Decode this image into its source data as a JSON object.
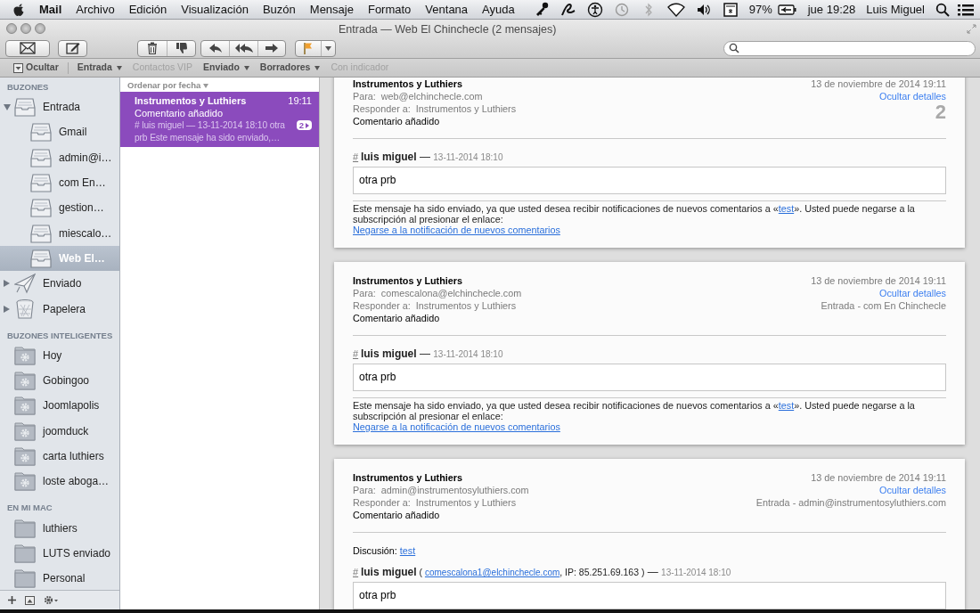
{
  "menubar": {
    "app": "Mail",
    "menus": [
      "Archivo",
      "Edición",
      "Visualización",
      "Buzón",
      "Mensaje",
      "Formato",
      "Ventana",
      "Ayuda"
    ],
    "battery": "97%",
    "clock": "jue 19:28",
    "user": "Luis Miguel"
  },
  "window": {
    "title": "Entrada — Web El Chinchecle (2 mensajes)"
  },
  "favorites": [
    {
      "label": "Ocultar",
      "kind": "hide",
      "disabled": false
    },
    {
      "label": "Entrada",
      "kind": "menu",
      "disabled": false
    },
    {
      "label": "Contactos VIP",
      "kind": "plain",
      "disabled": true
    },
    {
      "label": "Enviado",
      "kind": "menu",
      "disabled": false
    },
    {
      "label": "Borradores",
      "kind": "menu",
      "disabled": false
    },
    {
      "label": "Con indicador",
      "kind": "plain",
      "disabled": true
    }
  ],
  "sidebar": {
    "sections": [
      {
        "title": "BUZONES",
        "items": [
          {
            "label": "Entrada",
            "kind": "inbox",
            "expanded": true,
            "selected": false,
            "children": [
              {
                "label": "Gmail",
                "kind": "inbox",
                "selected": false
              },
              {
                "label": "admin@i…",
                "kind": "inbox",
                "selected": false
              },
              {
                "label": "com En…",
                "kind": "inbox",
                "selected": false
              },
              {
                "label": "gestion…",
                "kind": "inbox",
                "selected": false
              },
              {
                "label": "miescalo…",
                "kind": "inbox",
                "selected": false
              },
              {
                "label": "Web El…",
                "kind": "inbox",
                "selected": true
              }
            ]
          },
          {
            "label": "Enviado",
            "kind": "sent",
            "expanded": false,
            "selected": false
          },
          {
            "label": "Papelera",
            "kind": "trash",
            "expanded": false,
            "selected": false
          }
        ]
      },
      {
        "title": "BUZONES INTELIGENTES",
        "items": [
          {
            "label": "Hoy",
            "kind": "smart",
            "selected": false
          },
          {
            "label": "Gobingoo",
            "kind": "smart",
            "selected": false
          },
          {
            "label": "Joomlapolis",
            "kind": "smart",
            "selected": false
          },
          {
            "label": "joomduck",
            "kind": "smart",
            "selected": false
          },
          {
            "label": "carta luthiers",
            "kind": "smart",
            "selected": false
          },
          {
            "label": "loste aboga…",
            "kind": "smart",
            "selected": false
          }
        ]
      },
      {
        "title": "EN MI MAC",
        "items": [
          {
            "label": "luthiers",
            "kind": "folder",
            "selected": false
          },
          {
            "label": "LUTS enviado",
            "kind": "folder",
            "selected": false
          },
          {
            "label": "Personal",
            "kind": "folder",
            "selected": false
          }
        ]
      }
    ]
  },
  "message_list": {
    "sort": "Ordenar por fecha",
    "items": [
      {
        "sender": "Instrumentos y Luthiers",
        "time": "19:11",
        "subject": "Comentario añadido",
        "preview": "# luis miguel — 13-11-2014 18:10 otra prb Este mensaje ha sido enviado,…",
        "thread_count": "2",
        "selected": true
      }
    ]
  },
  "messages": [
    {
      "from": "Instrumentos y Luthiers",
      "to_label": "Para:",
      "to": "web@elchinchecle.com",
      "reply_label": "Responder a:",
      "reply_to": "Instrumentos y Luthiers",
      "subject": "Comentario añadido",
      "date": "13 de noviembre de 2014 19:11",
      "details_link": "Ocultar detalles",
      "thread_number": "2",
      "body": [
        {
          "kind": "comment",
          "hash": "#",
          "author": "luis miguel",
          "separator": "—",
          "date": "13-11-2014 18:10",
          "text": "otra prb"
        },
        {
          "kind": "notice",
          "before": "Este mensaje ha sido enviado, ya que usted desea recibir notificaciones de nuevos comentarios a «",
          "link": "test",
          "after": "». Usted puede negarse a la subscripción al presionar el enlace:"
        },
        {
          "kind": "unsubscribe",
          "link": "Negarse a la notificación de nuevos comentarios"
        }
      ]
    },
    {
      "from": "Instrumentos y Luthiers",
      "to_label": "Para:",
      "to": "comescalona@elchinchecle.com",
      "reply_label": "Responder a:",
      "reply_to": "Instrumentos y Luthiers",
      "subject": "Comentario añadido",
      "date": "13 de noviembre de 2014 19:11",
      "details_link": "Ocultar detalles",
      "mailbox": "Entrada - com En Chinchecle",
      "body": [
        {
          "kind": "comment",
          "hash": "#",
          "author": "luis miguel",
          "separator": "—",
          "date": "13-11-2014 18:10",
          "text": "otra prb"
        },
        {
          "kind": "notice",
          "before": "Este mensaje ha sido enviado, ya que usted desea recibir notificaciones de nuevos comentarios a «",
          "link": "test",
          "after": "». Usted puede negarse a la subscripción al presionar el enlace:"
        },
        {
          "kind": "unsubscribe",
          "link": "Negarse a la notificación de nuevos comentarios"
        }
      ]
    },
    {
      "from": "Instrumentos y Luthiers",
      "to_label": "Para:",
      "to": "admin@instrumentosyluthiers.com",
      "reply_label": "Responder a:",
      "reply_to": "Instrumentos y Luthiers",
      "subject": "Comentario añadido",
      "date": "13 de noviembre de 2014 19:11",
      "details_link": "Ocultar detalles",
      "mailbox": "Entrada - admin@instrumentosyluthiers.com",
      "body": [
        {
          "kind": "discussion",
          "label": "Discusión:",
          "link": "test"
        },
        {
          "kind": "comment",
          "hash": "#",
          "author": "luis miguel",
          "email_prefix": "(",
          "email": "comescalona1@elchinchecle.com",
          "email_suffix": ", IP: 85.251.69.163 )",
          "separator": "—",
          "date": "13-11-2014 18:10",
          "text": "otra prb"
        }
      ]
    }
  ]
}
